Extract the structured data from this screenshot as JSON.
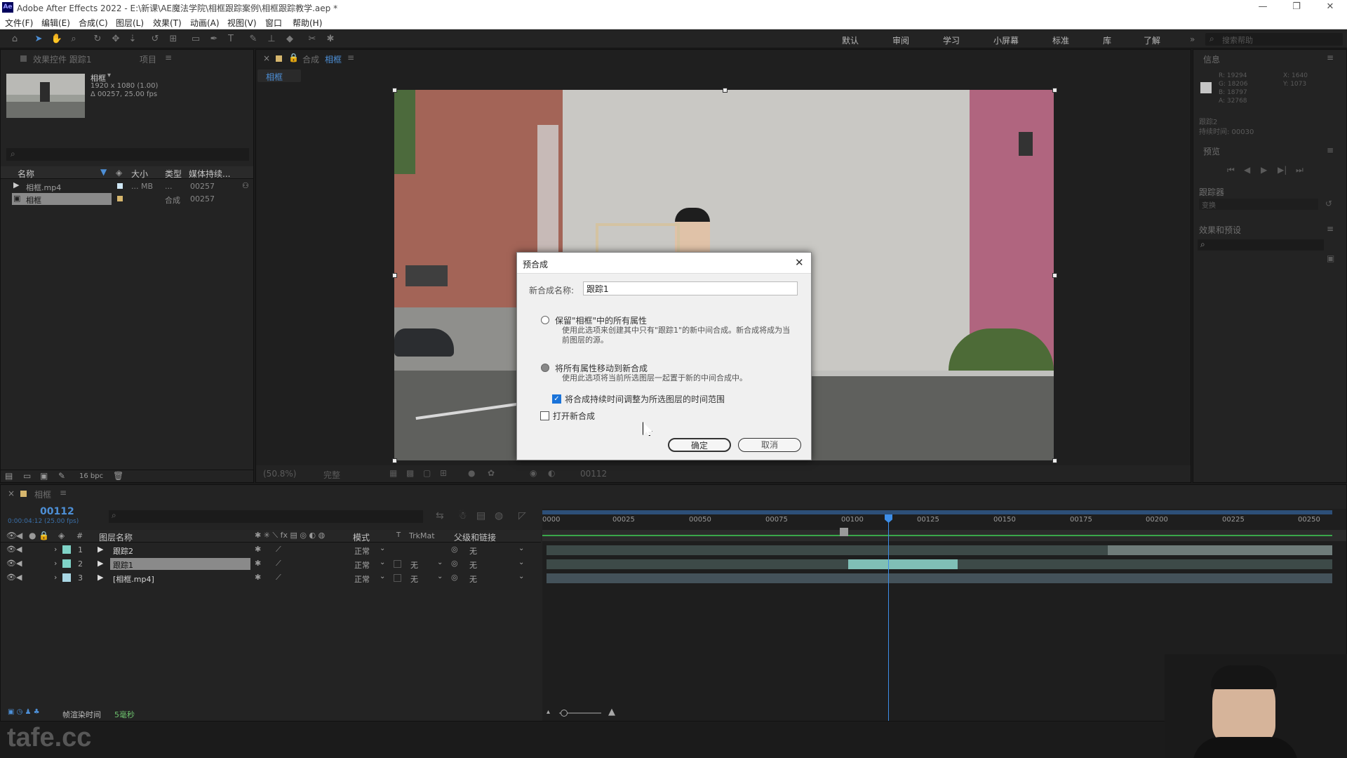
{
  "app": {
    "title": "Adobe After Effects 2022 - E:\\新课\\AE魔法学院\\相框跟踪案例\\相框跟踪教学.aep *",
    "logo": "Ae"
  },
  "menu": [
    "文件(F)",
    "编辑(E)",
    "合成(C)",
    "图层(L)",
    "效果(T)",
    "动画(A)",
    "视图(V)",
    "窗口",
    "帮助(H)"
  ],
  "workspaces": [
    "默认",
    "审阅",
    "学习",
    "小屏幕",
    "标准",
    "库",
    "了解"
  ],
  "search_help": "搜索帮助",
  "colors": {
    "accent": "#3d8ee8",
    "panel": "#232323",
    "dialog": "#f0f0f0",
    "label_teal": "#7fd3c7"
  },
  "project": {
    "tabs": [
      "效果控件 跟踪1",
      "项目"
    ],
    "item_name": "相框",
    "item_info": [
      "1920 x 1080 (1.00)",
      "Δ 00257, 25.00 fps"
    ],
    "columns": [
      "名称",
      "大小",
      "类型",
      "媒体持续..."
    ],
    "rows": [
      {
        "name": "相框.mp4",
        "size": "... MB",
        "type": "...",
        "duration": "00257"
      },
      {
        "name": "相框",
        "size": "",
        "type": "合成",
        "duration": "00257"
      }
    ],
    "bpc": "16 bpc"
  },
  "composition": {
    "tab_label": "合成",
    "tab_name": "相框",
    "sub_tab": "相框",
    "zoom": "(50.8%)",
    "quality": "完整",
    "frame": "00112"
  },
  "info_panel": {
    "title": "信息",
    "values": [
      "R: 19294",
      "G: 18206",
      "B: 18797",
      "A: 32768"
    ],
    "coords": [
      "X: 1640",
      "Y: 1073"
    ],
    "tracking": "跟踪2",
    "time": "持续时间: 00030"
  },
  "preview_panel": {
    "title": "预览"
  },
  "tracker_panel": {
    "title": "跟踪器",
    "mode": "变换"
  },
  "effects_panel": {
    "title": "效果和预设"
  },
  "dialog": {
    "title": "预合成",
    "name_label": "新合成名称:",
    "name_value": "跟踪1",
    "option1_title": "保留\"相框\"中的所有属性",
    "option1_desc": "使用此选项来创建其中只有\"跟踪1\"的新中间合成。新合成将成为当前图层的源。",
    "option2_title": "将所有属性移动到新合成",
    "option2_desc": "使用此选项将当前所选图层一起置于新的中间合成中。",
    "checkbox_duration": "将合成持续时间调整为所选图层的时间范围",
    "checkbox_open": "打开新合成",
    "ok": "确定",
    "cancel": "取消"
  },
  "timeline": {
    "tab": "相框",
    "timecode": "00112",
    "timecode_sub": "0:00:04:12 (25.00 fps)",
    "columns": [
      "图层名称",
      "模式",
      "T",
      "TrkMat",
      "父级和链接"
    ],
    "layers": [
      {
        "num": "1",
        "name": "跟踪2",
        "mode": "正常",
        "trkmat": "",
        "parent": "无"
      },
      {
        "num": "2",
        "name": "跟踪1",
        "mode": "正常",
        "trkmat": "无",
        "parent": "无"
      },
      {
        "num": "3",
        "name": "[相框.mp4]",
        "mode": "正常",
        "trkmat": "无",
        "parent": "无"
      }
    ],
    "ruler": [
      "0000",
      "00025",
      "00050",
      "00075",
      "00100",
      "00125",
      "00150",
      "00175",
      "00200",
      "00225",
      "00250"
    ],
    "render_time_label": "帧渲染时间",
    "render_time": "5毫秒"
  },
  "watermark": "tafe.cc"
}
